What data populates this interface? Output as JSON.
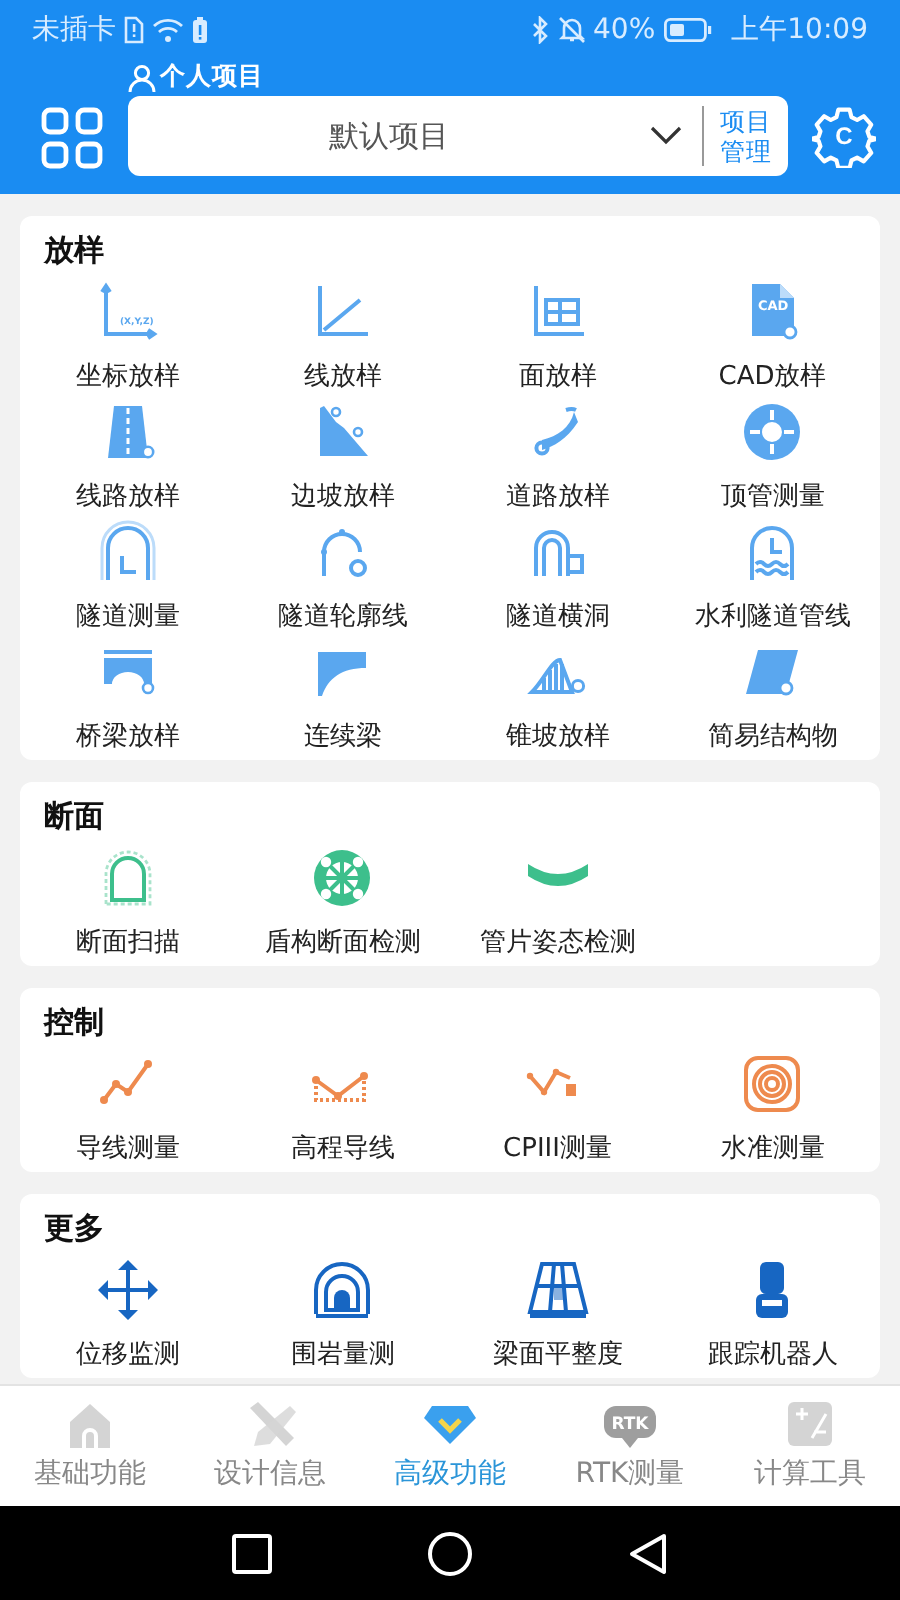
{
  "status_bar": {
    "carrier": "未插卡",
    "battery": "40%",
    "time": "上午10:09"
  },
  "header": {
    "project_label": "个人项目",
    "project": "默认项目",
    "manage_button": "项目管理",
    "settings_mark": "C"
  },
  "sections": [
    {
      "title": "放样",
      "color": "#5aa7ef",
      "items": [
        {
          "label": "坐标放样",
          "icon_text": "(X,Y,Z)"
        },
        {
          "label": "线放样"
        },
        {
          "label": "面放样"
        },
        {
          "label": "CAD放样",
          "icon_text": "CAD"
        },
        {
          "label": "线路放样"
        },
        {
          "label": "边坡放样"
        },
        {
          "label": "道路放样"
        },
        {
          "label": "顶管测量"
        },
        {
          "label": "隧道测量"
        },
        {
          "label": "隧道轮廓线"
        },
        {
          "label": "隧道横洞"
        },
        {
          "label": "水利隧道管线"
        },
        {
          "label": "桥梁放样"
        },
        {
          "label": "连续梁"
        },
        {
          "label": "锥坡放样"
        },
        {
          "label": "简易结构物"
        }
      ]
    },
    {
      "title": "断面",
      "color": "#3dbf8c",
      "items": [
        {
          "label": "断面扫描"
        },
        {
          "label": "盾构断面检测"
        },
        {
          "label": "管片姿态检测"
        }
      ]
    },
    {
      "title": "控制",
      "color": "#ee8a4e",
      "items": [
        {
          "label": "导线测量"
        },
        {
          "label": "高程导线"
        },
        {
          "label": "CPIII测量"
        },
        {
          "label": "水准测量"
        }
      ]
    },
    {
      "title": "更多",
      "color": "#1766c2",
      "items": [
        {
          "label": "位移监测"
        },
        {
          "label": "围岩量测"
        },
        {
          "label": "梁面平整度"
        },
        {
          "label": "跟踪机器人"
        }
      ]
    }
  ],
  "tabs": [
    {
      "label": "基础功能",
      "selected": false
    },
    {
      "label": "设计信息",
      "selected": false
    },
    {
      "label": "高级功能",
      "selected": true
    },
    {
      "label": "RTK测量",
      "selected": false,
      "icon_text": "RTK"
    },
    {
      "label": "计算工具",
      "selected": false
    }
  ]
}
